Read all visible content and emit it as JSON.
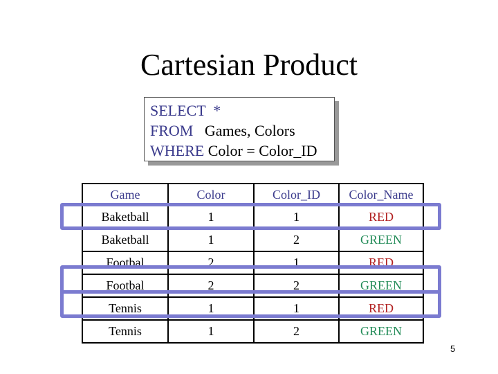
{
  "slide": {
    "title": "Cartesian Product",
    "page_number": "5"
  },
  "sql": {
    "lines": [
      {
        "keyword": "SELECT",
        "rest_keyword": "  *",
        "rest": ""
      },
      {
        "keyword": "FROM",
        "rest_keyword": "",
        "rest": "   Games, Colors"
      },
      {
        "keyword": "WHERE",
        "rest_keyword": "",
        "rest": " Color = Color_ID"
      }
    ]
  },
  "table": {
    "headers": [
      "Game",
      "Color",
      "Color_ID",
      "Color_Name"
    ],
    "rows": [
      {
        "game": "Baketball",
        "color": "1",
        "color_id": "1",
        "color_name": "RED",
        "highlighted": true
      },
      {
        "game": "Baketball",
        "color": "1",
        "color_id": "2",
        "color_name": "GREEN",
        "highlighted": false
      },
      {
        "game": "Footbal",
        "color": "2",
        "color_id": "1",
        "color_name": "RED",
        "highlighted": false
      },
      {
        "game": "Footbal",
        "color": "2",
        "color_id": "2",
        "color_name": "GREEN",
        "highlighted": true
      },
      {
        "game": "Tennis",
        "color": "1",
        "color_id": "1",
        "color_name": "RED",
        "highlighted": true
      },
      {
        "game": "Tennis",
        "color": "1",
        "color_id": "2",
        "color_name": "GREEN",
        "highlighted": false
      }
    ]
  },
  "colors": {
    "keyword": "#3a3a8c",
    "highlight": "#7b7bd0",
    "red": "#b22222",
    "green": "#228b57"
  }
}
